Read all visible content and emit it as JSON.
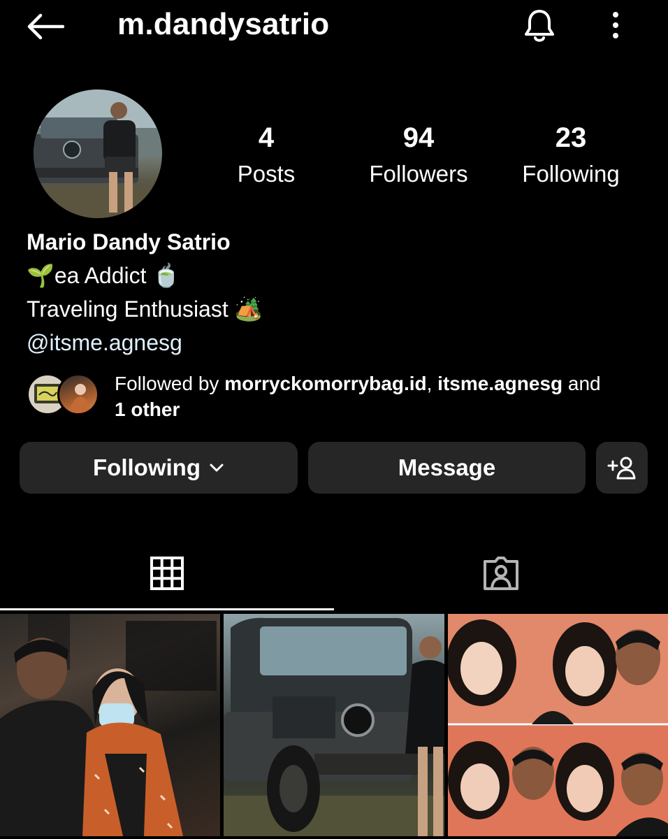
{
  "header": {
    "username": "m.dandysatrio",
    "icons": {
      "back": "arrow-left-icon",
      "notifications": "bell-icon",
      "more": "more-vertical-icon"
    }
  },
  "profile": {
    "stats": [
      {
        "key": "posts",
        "value": "4",
        "label": "Posts"
      },
      {
        "key": "followers",
        "value": "94",
        "label": "Followers"
      },
      {
        "key": "following",
        "value": "23",
        "label": "Following"
      }
    ],
    "bio": {
      "name": "Mario Dandy Satrio",
      "line1": "🌱ea Addict 🍵",
      "line2": "Traveling Enthusiast 🏕️",
      "mention": "@itsme.agnesg"
    },
    "followed_by": {
      "prefix": "Followed by ",
      "user1": "morryckomorrybag.id",
      "separator": ", ",
      "user2": "itsme.agnesg",
      "conjunction": " and",
      "others": "1 other"
    }
  },
  "actions": {
    "following_label": "Following",
    "message_label": "Message",
    "add_user_icon": "add-user-icon"
  },
  "tabs": {
    "active": "grid",
    "items": [
      {
        "name": "grid",
        "icon": "grid-icon"
      },
      {
        "name": "tagged",
        "icon": "tagged-person-icon"
      }
    ]
  },
  "colors": {
    "background": "#000000",
    "button": "#262626",
    "text": "#ffffff",
    "mention": "#e0f1ff"
  }
}
